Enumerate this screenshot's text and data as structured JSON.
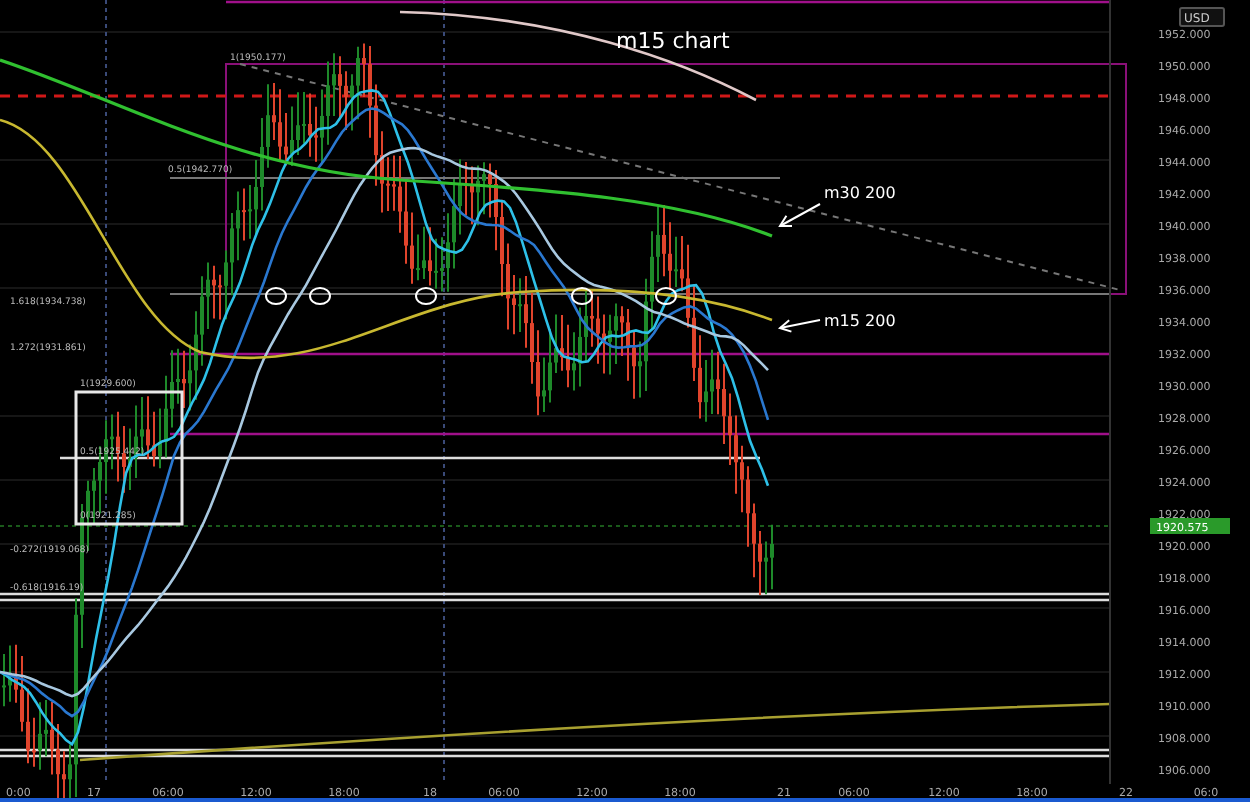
{
  "chart": {
    "title": "m15 chart",
    "annotations": [
      {
        "text": "m30 200"
      },
      {
        "text": "m15 200"
      }
    ],
    "fib_labels": [
      {
        "text": "1(1950.177)"
      },
      {
        "text": "0.5(1942.770)"
      },
      {
        "text": "1.618(1934.738)"
      },
      {
        "text": "1.272(1931.861)"
      },
      {
        "text": "1(1929.600)"
      },
      {
        "text": "0.5(1925.442)"
      },
      {
        "text": "0(1921.285)"
      },
      {
        "text": "-0.272(1919.068)"
      },
      {
        "text": "-0.618(1916.19)"
      }
    ],
    "price_badge": "1920.575",
    "y_axis": {
      "currency": "USD",
      "labels": [
        "1952.000",
        "1950.000",
        "1948.000",
        "1946.000",
        "1944.000",
        "1942.000",
        "1940.000",
        "1938.000",
        "1936.000",
        "1934.000",
        "1932.000",
        "1930.000",
        "1928.000",
        "1926.000",
        "1924.000",
        "1922.000",
        "1920.000",
        "1918.000",
        "1916.000",
        "1914.000",
        "1912.000",
        "1910.000",
        "1908.000",
        "1906.000"
      ]
    },
    "x_axis": {
      "labels": [
        "0:00",
        "17",
        "06:00",
        "12:00",
        "18:00",
        "18",
        "06:00",
        "12:00",
        "18:00",
        "21",
        "06:00",
        "12:00",
        "18:00",
        "22",
        "06:0"
      ]
    }
  }
}
